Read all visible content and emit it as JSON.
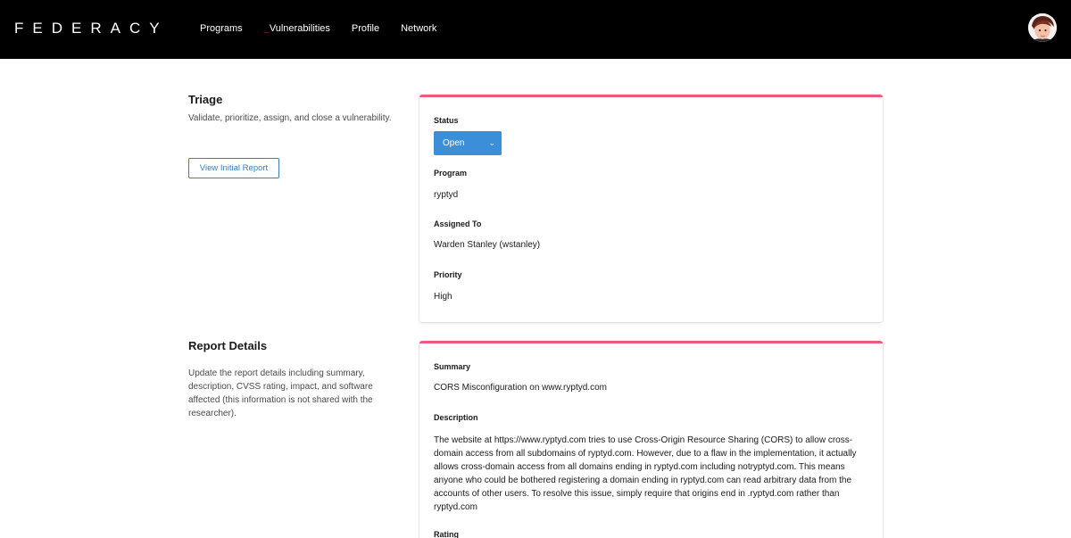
{
  "header": {
    "logo": "FEDERACY",
    "nav": [
      {
        "label": "Programs"
      },
      {
        "prefix": "_",
        "label": "Vulnerabilities"
      },
      {
        "label": "Profile"
      },
      {
        "label": "Network"
      }
    ],
    "avatar_icon": "user-avatar"
  },
  "triage": {
    "title": "Triage",
    "description": "Validate, prioritize, assign, and close a vulnerability.",
    "view_report_button": "View Initial Report",
    "status_label": "Status",
    "status_value": "Open",
    "program_label": "Program",
    "program_value": "ryptyd",
    "assigned_label": "Assigned To",
    "assigned_value": "Warden Stanley (wstanley)",
    "priority_label": "Priority",
    "priority_value": "High"
  },
  "report": {
    "title": "Report Details",
    "description": "Update the report details including summary, description, CVSS rating, impact, and software affected (this information is not shared with the researcher).",
    "summary_label": "Summary",
    "summary_value": "CORS Misconfiguration on www.ryptyd.com",
    "description_label": "Description",
    "description_value": "The website at https://www.ryptyd.com tries to use Cross-Origin Resource Sharing (CORS) to allow cross-domain access from all subdomains of ryptyd.com. However, due to a flaw in the implementation, it actually allows cross-domain access from all domains ending in ryptyd.com including notryptyd.com. This means anyone who could be bothered registering a domain ending in ryptyd.com can read arbitrary data from the accounts of other users. To resolve this issue, simply require that origins end in .ryptyd.com rather than ryptyd.com",
    "rating_label": "Rating"
  },
  "colors": {
    "accent": "#ee5a7a",
    "primary": "#3b8ed8",
    "link": "#3b7dbd",
    "topbar": "#000000"
  }
}
